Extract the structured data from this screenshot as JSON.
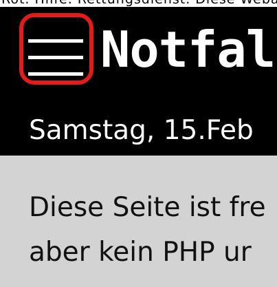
{
  "colors": {
    "header_bg": "#000000",
    "notice_bg": "#d3d3d3",
    "highlight": "#e41b1b"
  },
  "top_strip": {
    "text": "Rot. Hilfe. Rettungsdienst. Diese Webapp"
  },
  "header": {
    "menu_icon": "hamburger-menu-icon",
    "title": "Notfall",
    "date": "Samstag, 15.Feb"
  },
  "notice": {
    "lines": [
      "Diese Seite ist fre",
      "aber kein PHP ur"
    ]
  }
}
